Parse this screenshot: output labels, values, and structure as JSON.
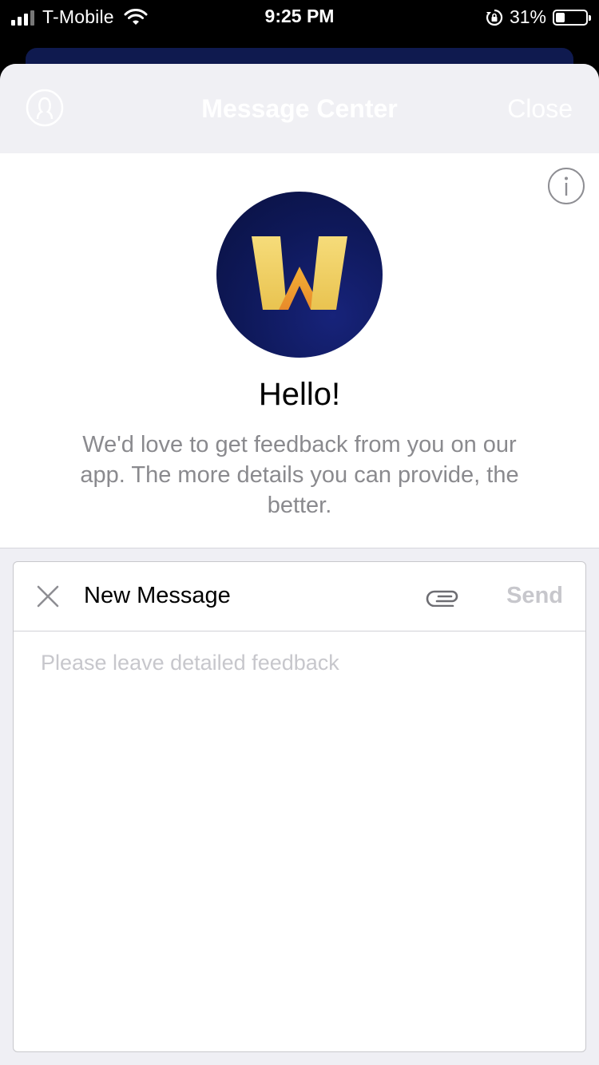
{
  "status_bar": {
    "carrier": "T-Mobile",
    "time": "9:25 PM",
    "battery_percent_label": "31%",
    "battery_level": 0.31,
    "icons": [
      "cellular-signal-icon",
      "wifi-icon",
      "orientation-lock-icon",
      "battery-icon"
    ]
  },
  "navbar": {
    "title": "Message Center",
    "close_label": "Close",
    "title_color": "#ffffff",
    "left_icon": "profile-icon"
  },
  "greeting": {
    "title": "Hello!",
    "body": "We'd love to get feedback from you on our app. The more details you can provide, the better.",
    "info_icon": "info-icon",
    "logo_icon": "app-logo-w"
  },
  "composer": {
    "title": "New Message",
    "send_label": "Send",
    "placeholder": "Please leave detailed feedback",
    "value": "",
    "cancel_icon": "close-icon",
    "attach_icon": "paperclip-icon"
  },
  "colors": {
    "brand_navy": "#0e1858",
    "logo_gold": "#f2d36b",
    "disabled_gray": "#c7c7cc",
    "secondary_text": "#8a8a8e"
  }
}
